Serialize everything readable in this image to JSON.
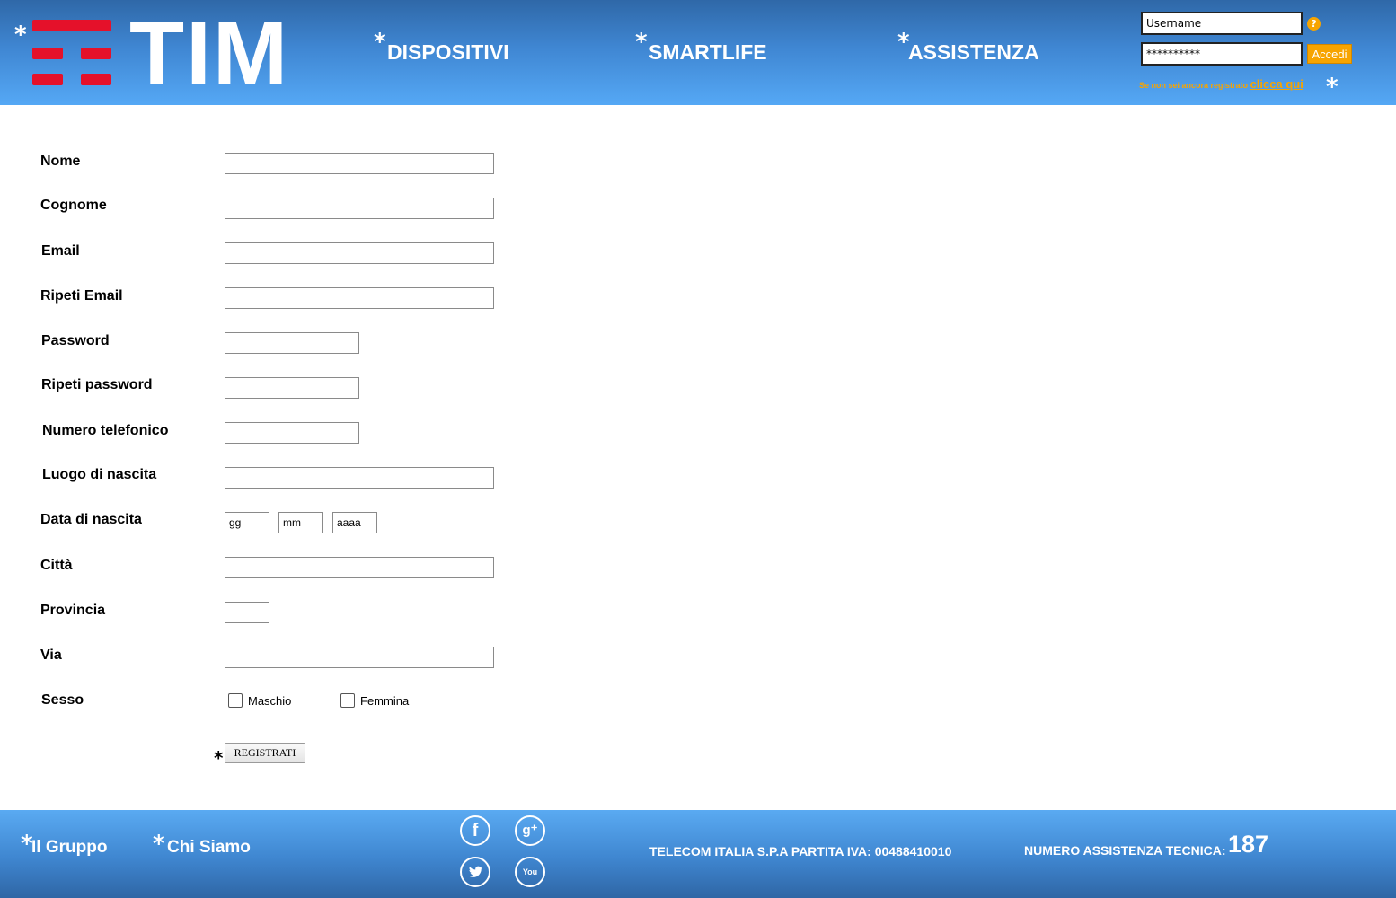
{
  "header": {
    "logo": "TIM",
    "nav": [
      {
        "label": "DISPOSITIVI"
      },
      {
        "label": "SMARTLIFE"
      },
      {
        "label": "ASSISTENZA"
      }
    ],
    "login": {
      "username_value": "Username",
      "password_value": "**********",
      "help_glyph": "?",
      "submit_label": "Accedi",
      "register_hint": "Se non sei ancora registrato",
      "register_link": "clicca qui"
    },
    "marker": "*"
  },
  "form": {
    "fields": [
      {
        "label": "Nome"
      },
      {
        "label": "Cognome"
      },
      {
        "label": "Email"
      },
      {
        "label": "Ripeti Email"
      },
      {
        "label": "Password"
      },
      {
        "label": "Ripeti password"
      },
      {
        "label": "Numero telefonico"
      },
      {
        "label": "Luogo di nascita"
      },
      {
        "label": "Data di nascita"
      },
      {
        "label": "Città"
      },
      {
        "label": "Provincia"
      },
      {
        "label": "Via"
      },
      {
        "label": "Sesso"
      }
    ],
    "date_placeholders": {
      "day": "gg",
      "month": "mm",
      "year": "aaaa"
    },
    "gender_options": [
      "Maschio",
      "Femmina"
    ],
    "submit_label": "REGISTRATI"
  },
  "footer": {
    "links": [
      {
        "label": "Il Gruppo"
      },
      {
        "label": "Chi Siamo"
      }
    ],
    "social_icons": [
      "facebook-icon",
      "google-plus-icon",
      "twitter-icon",
      "youtube-icon"
    ],
    "company": "TELECOM ITALIA S.P.A PARTITA IVA: 00488410010",
    "support_label": "NUMERO ASSISTENZA TECNICA:",
    "support_number": "187"
  },
  "colors": {
    "header_blue": "#3f86d2",
    "brand_red": "#e5112a",
    "accent_orange": "#f7a400",
    "footer_blue": "#3f86d0"
  }
}
